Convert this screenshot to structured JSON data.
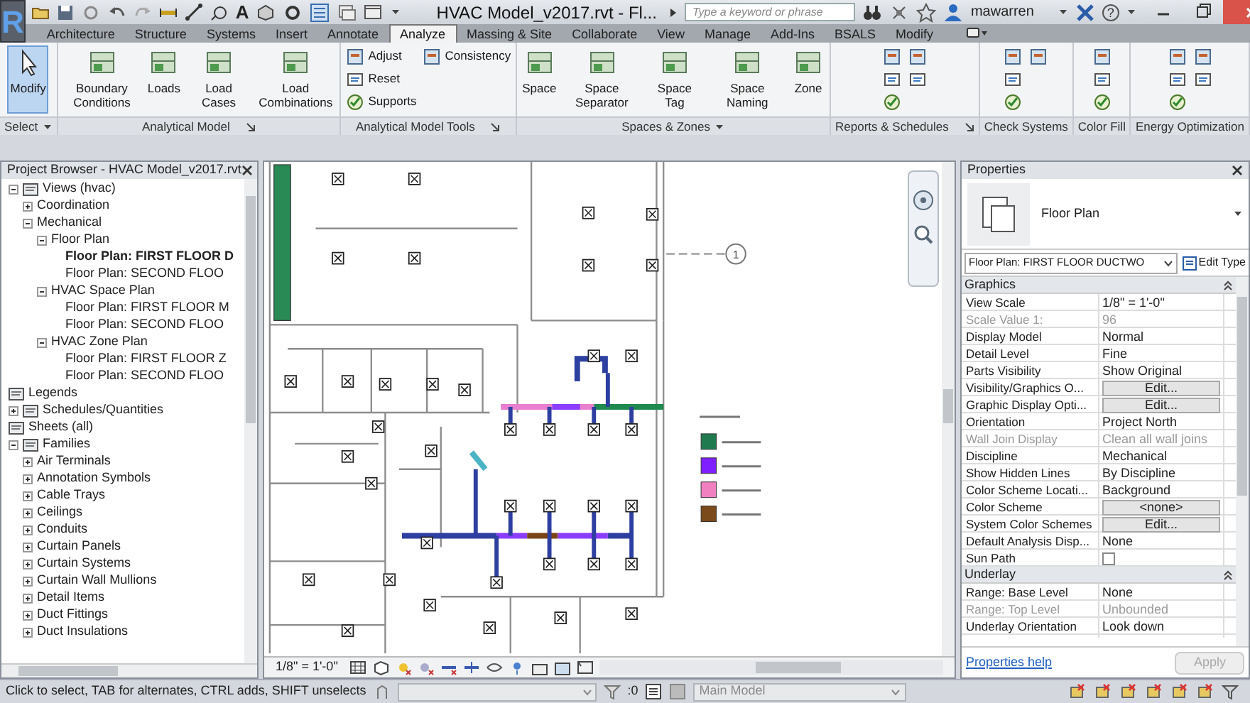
{
  "title_bar": {
    "app_logo": "R",
    "text_tool_glyph": "A",
    "title": "HVAC Model_v2017.rvt - Fl...",
    "search": {
      "placeholder": "Type a keyword or phrase"
    },
    "user": "mawarren",
    "help_glyph": "?"
  },
  "tabs": [
    {
      "label": "Architecture",
      "selected": false
    },
    {
      "label": "Structure",
      "selected": false
    },
    {
      "label": "Systems",
      "selected": false
    },
    {
      "label": "Insert",
      "selected": false
    },
    {
      "label": "Annotate",
      "selected": false
    },
    {
      "label": "Analyze",
      "selected": true
    },
    {
      "label": "Massing & Site",
      "selected": false
    },
    {
      "label": "Collaborate",
      "selected": false
    },
    {
      "label": "View",
      "selected": false
    },
    {
      "label": "Manage",
      "selected": false
    },
    {
      "label": "Add-Ins",
      "selected": false
    },
    {
      "label": "BSALS",
      "selected": false
    },
    {
      "label": "Modify",
      "selected": false
    }
  ],
  "ribbon": {
    "panels": [
      {
        "title": "Select",
        "has_dropdown": true,
        "has_launcher": false,
        "tools": [
          {
            "label": "Modify",
            "kind": "large",
            "active": true
          }
        ]
      },
      {
        "title": "Analytical Model",
        "has_dropdown": false,
        "has_launcher": true,
        "tools": [
          {
            "label": "Boundary Conditions",
            "kind": "large",
            "active": false
          },
          {
            "label": "Loads",
            "kind": "large",
            "active": false
          },
          {
            "label": "Load Cases",
            "kind": "large",
            "active": false
          },
          {
            "label": "Load Combinations",
            "kind": "large",
            "active": false
          }
        ]
      },
      {
        "title": "Analytical Model Tools",
        "has_dropdown": false,
        "has_launcher": true,
        "tools": [
          {
            "label": "Adjust",
            "kind": "small",
            "active": false
          },
          {
            "label": "Reset",
            "kind": "small",
            "active": false
          },
          {
            "label": "Supports",
            "kind": "small",
            "active": false
          },
          {
            "label": "Consistency",
            "kind": "small",
            "active": false
          }
        ]
      },
      {
        "title": "Spaces & Zones",
        "has_dropdown": true,
        "has_launcher": false,
        "tools": [
          {
            "label": "Space",
            "kind": "large",
            "active": false
          },
          {
            "label": "Space Separator",
            "kind": "large",
            "active": false
          },
          {
            "label": "Space Tag",
            "kind": "large",
            "active": false
          },
          {
            "label": "Space Naming",
            "kind": "large",
            "active": false
          },
          {
            "label": "Zone",
            "kind": "large",
            "active": false
          }
        ]
      },
      {
        "title": "Reports & Schedules",
        "has_dropdown": false,
        "has_launcher": true,
        "tools": [
          {
            "kind": "icon",
            "active": false
          },
          {
            "kind": "icon",
            "active": false
          },
          {
            "kind": "icon",
            "active": false
          },
          {
            "kind": "icon",
            "active": false
          },
          {
            "kind": "icon",
            "active": false
          }
        ]
      },
      {
        "title": "Check Systems",
        "has_dropdown": false,
        "has_launcher": false,
        "tools": [
          {
            "kind": "icon",
            "active": false
          },
          {
            "kind": "icon",
            "active": false
          },
          {
            "kind": "icon",
            "active": false
          },
          {
            "kind": "icon",
            "active": false
          }
        ]
      },
      {
        "title": "Color Fill",
        "has_dropdown": false,
        "has_launcher": false,
        "tools": [
          {
            "kind": "icon",
            "active": false
          },
          {
            "kind": "icon",
            "active": false
          },
          {
            "kind": "icon",
            "active": false
          }
        ]
      },
      {
        "title": "Energy Optimization",
        "has_dropdown": false,
        "has_launcher": false,
        "tools": [
          {
            "kind": "icon",
            "active": false
          },
          {
            "kind": "icon",
            "active": false
          },
          {
            "kind": "icon",
            "active": false
          },
          {
            "kind": "icon",
            "active": false
          },
          {
            "kind": "icon",
            "active": false
          }
        ]
      }
    ]
  },
  "project_browser": {
    "title": "Project Browser - HVAC Model_v2017.rvt",
    "tree": [
      {
        "label": "Views (hvac)",
        "expanded": true,
        "children": [
          {
            "label": "Coordination",
            "expanded": false
          },
          {
            "label": "Mechanical",
            "expanded": true,
            "children": [
              {
                "label": "Floor Plan",
                "expanded": true,
                "children": [
                  {
                    "label": "Floor Plan: FIRST FLOOR D",
                    "selected": true
                  },
                  {
                    "label": "Floor Plan: SECOND FLOO",
                    "selected": false
                  }
                ]
              },
              {
                "label": "HVAC Space Plan",
                "expanded": true,
                "children": [
                  {
                    "label": "Floor Plan: FIRST FLOOR M",
                    "selected": false
                  },
                  {
                    "label": "Floor Plan: SECOND FLOO",
                    "selected": false
                  }
                ]
              },
              {
                "label": "HVAC Zone Plan",
                "expanded": true,
                "children": [
                  {
                    "label": "Floor Plan: FIRST FLOOR Z",
                    "selected": false
                  },
                  {
                    "label": "Floor Plan: SECOND FLOO",
                    "selected": false
                  }
                ]
              }
            ]
          }
        ]
      },
      {
        "label": "Legends"
      },
      {
        "label": "Schedules/Quantities",
        "expanded": false
      },
      {
        "label": "Sheets (all)"
      },
      {
        "label": "Families",
        "expanded": true,
        "children": [
          {
            "label": "Air Terminals",
            "expanded": false
          },
          {
            "label": "Annotation Symbols",
            "expanded": false
          },
          {
            "label": "Cable Trays",
            "expanded": false
          },
          {
            "label": "Ceilings",
            "expanded": false
          },
          {
            "label": "Conduits",
            "expanded": false
          },
          {
            "label": "Curtain Panels",
            "expanded": false
          },
          {
            "label": "Curtain Systems",
            "expanded": false
          },
          {
            "label": "Curtain Wall Mullions",
            "expanded": false
          },
          {
            "label": "Detail Items",
            "expanded": false
          },
          {
            "label": "Duct Fittings",
            "expanded": false
          },
          {
            "label": "Duct Insulations",
            "expanded": false
          }
        ]
      }
    ]
  },
  "canvas": {
    "grid_bubble": "1",
    "view_scale": "1/8\" = 1'-0\""
  },
  "properties": {
    "title": "Properties",
    "type_name": "Floor Plan",
    "instance": "Floor Plan: FIRST FLOOR DUCTWO",
    "edit_type": "Edit Type",
    "groups": [
      {
        "title": "Graphics",
        "expanded": true,
        "rows": [
          {
            "name": "View Scale",
            "value": "1/8\" = 1'-0\"",
            "kind": "text",
            "disabled": false
          },
          {
            "name": "Scale Value    1:",
            "value": "96",
            "kind": "text",
            "disabled": true
          },
          {
            "name": "Display Model",
            "value": "Normal",
            "kind": "text",
            "disabled": false
          },
          {
            "name": "Detail Level",
            "value": "Fine",
            "kind": "text",
            "disabled": false
          },
          {
            "name": "Parts Visibility",
            "value": "Show Original",
            "kind": "text",
            "disabled": false
          },
          {
            "name": "Visibility/Graphics O...",
            "value": "Edit...",
            "kind": "button",
            "disabled": false
          },
          {
            "name": "Graphic Display Opti...",
            "value": "Edit...",
            "kind": "button",
            "disabled": false
          },
          {
            "name": "Orientation",
            "value": "Project North",
            "kind": "text",
            "disabled": false
          },
          {
            "name": "Wall Join Display",
            "value": "Clean all wall joins",
            "kind": "text",
            "disabled": true
          },
          {
            "name": "Discipline",
            "value": "Mechanical",
            "kind": "text",
            "disabled": false
          },
          {
            "name": "Show Hidden Lines",
            "value": "By Discipline",
            "kind": "text",
            "disabled": false
          },
          {
            "name": "Color Scheme Locati...",
            "value": "Background",
            "kind": "text",
            "disabled": false
          },
          {
            "name": "Color Scheme",
            "value": "<none>",
            "kind": "button",
            "disabled": false
          },
          {
            "name": "System Color Schemes",
            "value": "Edit...",
            "kind": "button",
            "disabled": false
          },
          {
            "name": "Default Analysis Disp...",
            "value": "None",
            "kind": "text",
            "disabled": false
          },
          {
            "name": "Sun Path",
            "kind": "checkbox",
            "checked": false,
            "disabled": false
          }
        ]
      },
      {
        "title": "Underlay",
        "expanded": true,
        "rows": [
          {
            "name": "Range: Base Level",
            "value": "None",
            "kind": "text",
            "disabled": false
          },
          {
            "name": "Range: Top Level",
            "value": "Unbounded",
            "kind": "text",
            "disabled": true
          },
          {
            "name": "Underlay Orientation",
            "value": "Look down",
            "kind": "text",
            "disabled": false
          }
        ]
      }
    ],
    "help_link": "Properties help",
    "apply": {
      "label": "Apply",
      "disabled": true
    }
  },
  "status_bar": {
    "message": "Click to select, TAB for alternates, CTRL adds, SHIFT unselects",
    "selection_count": ":0",
    "workset": "Main Model"
  }
}
